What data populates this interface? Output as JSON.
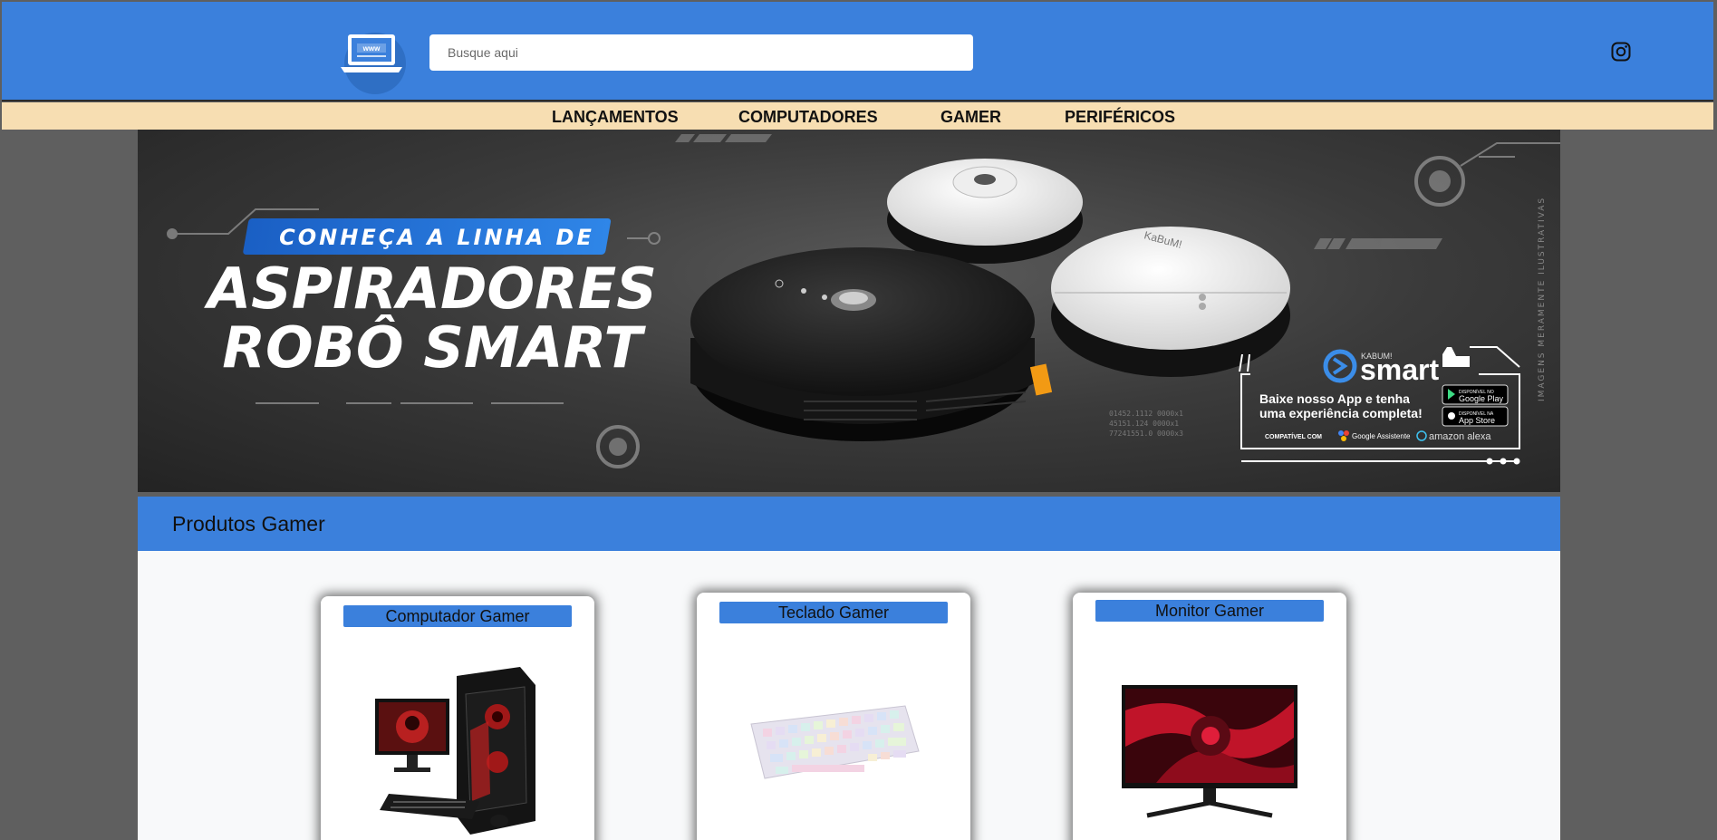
{
  "header": {
    "logo_text": "www",
    "search": {
      "placeholder": "Busque aqui",
      "value": ""
    },
    "social_icon": "instagram-icon"
  },
  "nav": {
    "items": [
      {
        "label": "LANÇAMENTOS"
      },
      {
        "label": "COMPUTADORES"
      },
      {
        "label": "GAMER"
      },
      {
        "label": "PERIFÉRICOS"
      }
    ]
  },
  "banner": {
    "headline_small": "CONHEÇA A LINHA DE",
    "headline_line1": "ASPIRADORES",
    "headline_line2": "ROBÔ SMART",
    "brand_small": "KABUM!",
    "brand": "smart",
    "app_promo_line1": "Baixe nosso App e tenha",
    "app_promo_line2": "uma experiência completa!",
    "store1_small": "DISPONÍVEL NO",
    "store1": "Google Play",
    "store2_small": "DISPONÍVEL NA",
    "store2": "App Store",
    "compat_label": "COMPATÍVEL COM",
    "compat1": "Google Assistente",
    "compat2": "amazon alexa",
    "disclaimer": "IMAGENS MERAMENTE ILUSTRATIVAS",
    "product_brand": "KaBuM!",
    "spec_line1": "01452.1112   0000x1",
    "spec_line2": "45151.124    0000x1",
    "spec_line3": "77241551.0   0000x3"
  },
  "section": {
    "title": "Produtos Gamer"
  },
  "products": [
    {
      "label": "Computador Gamer"
    },
    {
      "label": "Teclado Gamer"
    },
    {
      "label": "Monitor Gamer"
    }
  ],
  "colors": {
    "header_bg": "#3b80dc",
    "nav_bg": "#f7deb2",
    "page_bg": "#5f5f5f",
    "accent_blue": "#1f6fd1"
  }
}
